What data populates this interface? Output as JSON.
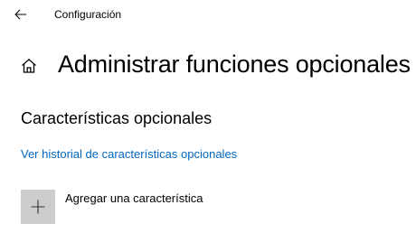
{
  "window": {
    "title": "Configuración",
    "back_icon": "arrow-left-icon"
  },
  "header": {
    "home_icon": "home-icon",
    "title": "Administrar funciones opcionales"
  },
  "main": {
    "section_title": "Características opcionales",
    "history_link": "Ver historial de características opcionales",
    "add_feature": {
      "label": "Agregar una característica",
      "icon": "plus-icon"
    }
  },
  "colors": {
    "link": "#0067c0",
    "tile": "#cccccc",
    "background": "#ffffff",
    "text": "#000000"
  }
}
